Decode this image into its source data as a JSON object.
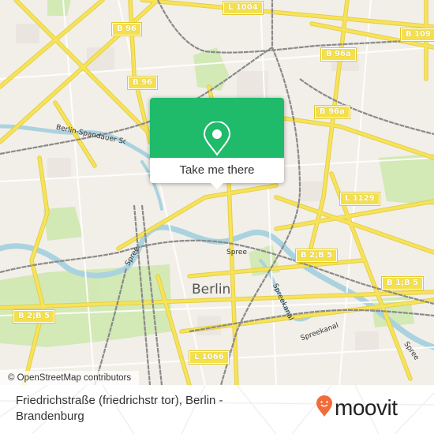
{
  "map": {
    "city_label": "Berlin",
    "attribution": "© OpenStreetMap contributors",
    "road_shields": [
      {
        "id": "l1004",
        "label": "L 1004"
      },
      {
        "id": "b109",
        "label": "B 109"
      },
      {
        "id": "b96-nw1",
        "label": "B 96"
      },
      {
        "id": "b96-nw2",
        "label": "B 96"
      },
      {
        "id": "b96a-n",
        "label": "B 96a"
      },
      {
        "id": "b96a-ne",
        "label": "B 96a"
      },
      {
        "id": "l1129",
        "label": "L 1129"
      },
      {
        "id": "b2b5-e",
        "label": "B 2;B 5"
      },
      {
        "id": "b1b5",
        "label": "B 1;B 5"
      },
      {
        "id": "b2b5-w",
        "label": "B 2;B 5"
      },
      {
        "id": "l1066",
        "label": "L 1066"
      }
    ],
    "water_labels": [
      {
        "id": "spree-center",
        "label": "Spree"
      },
      {
        "id": "spree-west",
        "label": "Spree"
      },
      {
        "id": "spree-east",
        "label": "Spree"
      },
      {
        "id": "spreekanal-1",
        "label": "Spreekanal"
      },
      {
        "id": "spreekanal-2",
        "label": "Spreekanal"
      },
      {
        "id": "spandauer-kanal",
        "label": "Berlin-Spandauer Schifffahrtskanal"
      }
    ],
    "colors": {
      "land": "#f2efe9",
      "park": "#c8e6a5",
      "water": "#aad3df",
      "major_road": "#f7e35a",
      "rail": "#8a8a8a"
    }
  },
  "popup": {
    "icon": "map-pin-icon",
    "cta_label": "Take me there",
    "accent_color": "#1fba6a"
  },
  "footer": {
    "stop_name": "Friedrichstraße (friedrichstr tor), Berlin - Brandenburg",
    "brand": "moovit",
    "brand_icon": "moovit-pin-icon",
    "brand_color": "#f26b3a"
  }
}
